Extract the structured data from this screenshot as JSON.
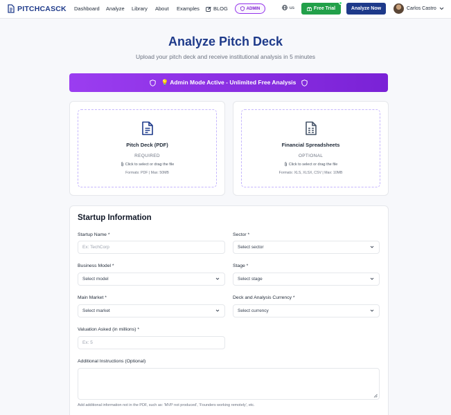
{
  "brand": {
    "name": "PITCHCASCK"
  },
  "nav": {
    "links": [
      "Dashboard",
      "Analyze",
      "Library",
      "About",
      "Examples",
      "BLOG"
    ],
    "admin_label": "ADMIN",
    "lang": "us",
    "trial_label": "Free Trial",
    "analyze_label": "Analyze Now",
    "user_name": "Carlos Castro"
  },
  "header": {
    "title": "Analyze Pitch Deck",
    "subtitle": "Upload your pitch deck and receive institutional analysis in 5 minutes"
  },
  "banner": {
    "text": "💡 Admin Mode Active - Unlimited Free Analysis"
  },
  "uploads": [
    {
      "title": "Pitch Deck (PDF)",
      "tag": "REQUIRED",
      "hint": "Click to select or drag the file",
      "formats": "Formats: PDF | Max: 50MB"
    },
    {
      "title": "Financial Spreadsheets",
      "tag": "OPTIONAL",
      "hint": "Click to select or drag the file",
      "formats": "Formats: XLS, XLSX, CSV | Max: 10MB"
    }
  ],
  "form": {
    "title": "Startup Information",
    "startup_name": {
      "label": "Startup Name *",
      "placeholder": "Ex: TechCorp"
    },
    "sector": {
      "label": "Sector *",
      "value": "Select sector"
    },
    "business_model": {
      "label": "Business Model *",
      "value": "Select model"
    },
    "stage": {
      "label": "Stage *",
      "value": "Select stage"
    },
    "main_market": {
      "label": "Main Market *",
      "value": "Select market"
    },
    "currency": {
      "label": "Deck and Analysis Currency *",
      "value": "Select currency"
    },
    "valuation": {
      "label": "Valuation Asked (in millions) *",
      "placeholder": "Ex: 5"
    },
    "instructions": {
      "label": "Additional Instructions (Optional)",
      "help": "Add additional information not in the PDF, such as: 'MVP not produced', 'Founders working remotely', etc."
    }
  },
  "colors": {
    "brand": "#1e3a8a",
    "accent": "#9333ea",
    "trial": "#22a04a"
  }
}
